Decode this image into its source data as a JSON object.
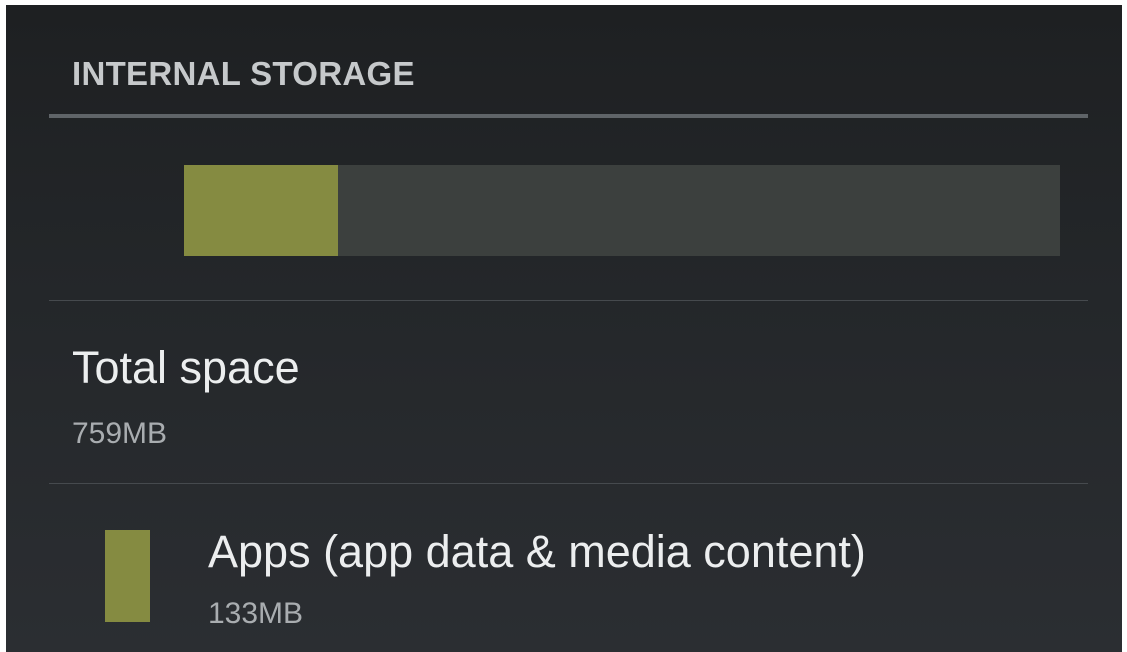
{
  "storage": {
    "section_title": "INTERNAL STORAGE",
    "usage_fraction": 0.176,
    "total": {
      "label": "Total space",
      "value": "759MB"
    },
    "categories": [
      {
        "label": "Apps (app data & media content)",
        "value": "133MB",
        "color": "#858b41"
      }
    ]
  },
  "colors": {
    "background": "#24272a",
    "bar_track": "#3c403e",
    "apps_accent": "#858b41"
  }
}
